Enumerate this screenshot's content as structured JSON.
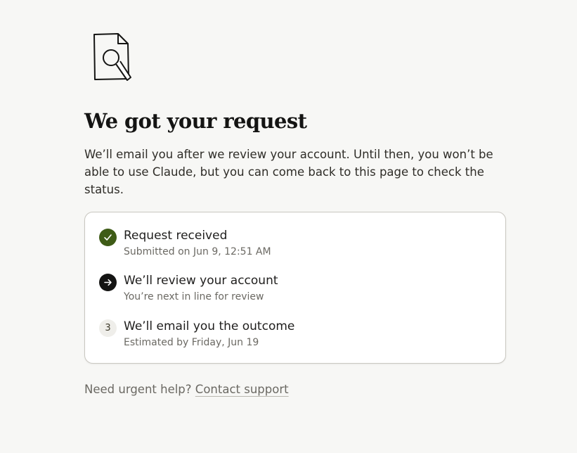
{
  "illustration": {
    "icon": "document-magnifier-icon"
  },
  "header": {
    "title": "We got your request",
    "description": "We’ll email you after we review your account. Until then, you won’t be able to use Claude, but you can come back to this page to check the status."
  },
  "steps": [
    {
      "status": "done",
      "icon": "check-icon",
      "color": "#3e5b16",
      "title": "Request received",
      "subtitle": "Submitted on Jun 9, 12:51 AM"
    },
    {
      "status": "current",
      "icon": "arrow-right-icon",
      "color": "#141413",
      "title": "We’ll review your account",
      "subtitle": "You’re next in line for review"
    },
    {
      "status": "pending",
      "number": "3",
      "title": "We’ll email you the outcome",
      "subtitle": "Estimated by Friday, Jun 19"
    }
  ],
  "footer": {
    "help_text": "Need urgent help?",
    "contact_link": "Contact support"
  }
}
